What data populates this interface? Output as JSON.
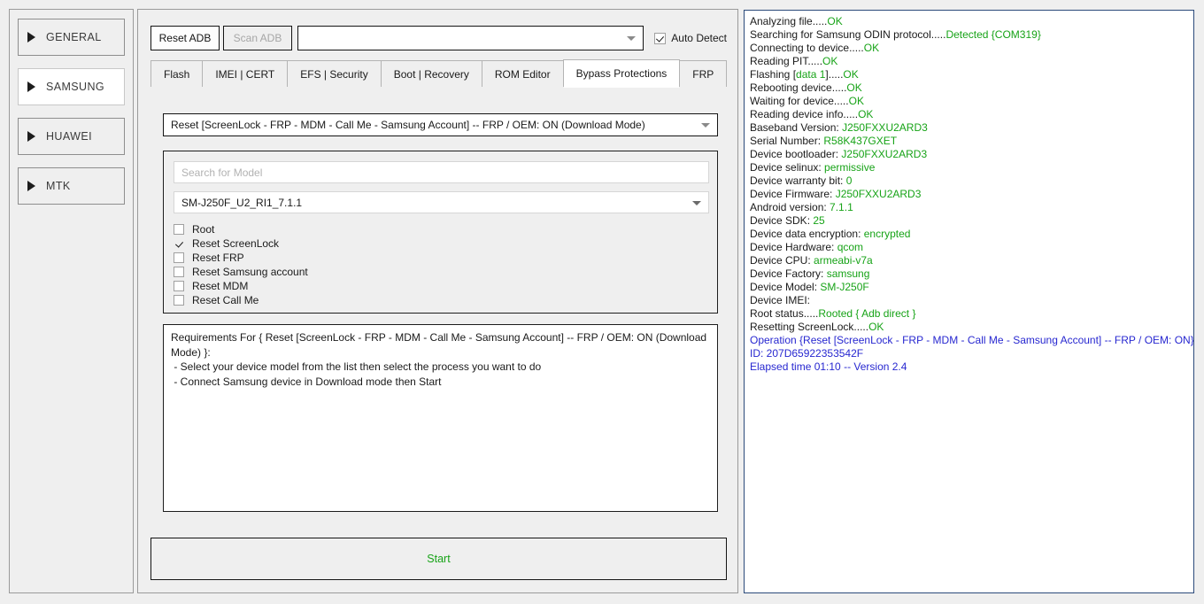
{
  "sidebar": {
    "items": [
      {
        "label": "GENERAL",
        "selected": false
      },
      {
        "label": "SAMSUNG",
        "selected": true
      },
      {
        "label": "HUAWEI",
        "selected": false
      },
      {
        "label": "MTK",
        "selected": false
      }
    ]
  },
  "toolbar": {
    "reset_adb_label": "Reset ADB",
    "scan_adb_label": "Scan ADB",
    "port_combo_value": "",
    "auto_detect_label": "Auto Detect",
    "auto_detect_checked": true
  },
  "tabs": [
    {
      "label": "Flash",
      "active": false
    },
    {
      "label": "IMEI | CERT",
      "active": false
    },
    {
      "label": "EFS | Security",
      "active": false
    },
    {
      "label": "Boot | Recovery",
      "active": false
    },
    {
      "label": "ROM Editor",
      "active": false
    },
    {
      "label": "Bypass Protections",
      "active": true
    },
    {
      "label": "FRP",
      "active": false
    }
  ],
  "main": {
    "operation_combo_value": "Reset [ScreenLock - FRP - MDM - Call Me - Samsung Account] -- FRP / OEM: ON (Download Mode)",
    "search_placeholder": "Search for Model",
    "search_value": "",
    "model_combo_value": "SM-J250F_U2_RI1_7.1.1",
    "options": [
      {
        "label": "Root",
        "checked": false
      },
      {
        "label": "Reset ScreenLock",
        "checked": true
      },
      {
        "label": "Reset FRP",
        "checked": false
      },
      {
        "label": "Reset Samsung account",
        "checked": false
      },
      {
        "label": "Reset MDM",
        "checked": false
      },
      {
        "label": "Reset Call Me",
        "checked": false
      }
    ],
    "requirements_text": "Requirements For { Reset [ScreenLock - FRP - MDM - Call Me - Samsung Account] -- FRP / OEM: ON (Download Mode) }:\n - Select your device model from the list then select the process you want to do\n - Connect Samsung device in Download mode then Start",
    "start_label": "Start"
  },
  "log": {
    "lines": [
      [
        {
          "t": "Analyzing file.....",
          "c": "k"
        },
        {
          "t": "OK",
          "c": "g"
        }
      ],
      [
        {
          "t": "Searching for Samsung ODIN protocol.....",
          "c": "k"
        },
        {
          "t": "Detected {COM319}",
          "c": "g"
        }
      ],
      [
        {
          "t": "Connecting to device.....",
          "c": "k"
        },
        {
          "t": "OK",
          "c": "g"
        }
      ],
      [
        {
          "t": "Reading PIT.....",
          "c": "k"
        },
        {
          "t": "OK",
          "c": "g"
        }
      ],
      [
        {
          "t": "Flashing [",
          "c": "k"
        },
        {
          "t": "data 1",
          "c": "g"
        },
        {
          "t": "].....",
          "c": "k"
        },
        {
          "t": "OK",
          "c": "g"
        }
      ],
      [
        {
          "t": "Rebooting device.....",
          "c": "k"
        },
        {
          "t": "OK",
          "c": "g"
        }
      ],
      [
        {
          "t": "Waiting for device.....",
          "c": "k"
        },
        {
          "t": "OK",
          "c": "g"
        }
      ],
      [
        {
          "t": "Reading device info.....",
          "c": "k"
        },
        {
          "t": "OK",
          "c": "g"
        }
      ],
      [
        {
          "t": "Baseband Version: ",
          "c": "k"
        },
        {
          "t": "J250FXXU2ARD3",
          "c": "g"
        }
      ],
      [
        {
          "t": "Serial Number: ",
          "c": "k"
        },
        {
          "t": "R58K437GXET",
          "c": "g"
        }
      ],
      [
        {
          "t": "Device bootloader: ",
          "c": "k"
        },
        {
          "t": "J250FXXU2ARD3",
          "c": "g"
        }
      ],
      [
        {
          "t": "Device selinux: ",
          "c": "k"
        },
        {
          "t": "permissive",
          "c": "g"
        }
      ],
      [
        {
          "t": "Device warranty bit: ",
          "c": "k"
        },
        {
          "t": "0",
          "c": "g"
        }
      ],
      [
        {
          "t": "Device Firmware: ",
          "c": "k"
        },
        {
          "t": "J250FXXU2ARD3",
          "c": "g"
        }
      ],
      [
        {
          "t": "Android version: ",
          "c": "k"
        },
        {
          "t": "7.1.1",
          "c": "g"
        }
      ],
      [
        {
          "t": "Device SDK: ",
          "c": "k"
        },
        {
          "t": "25",
          "c": "g"
        }
      ],
      [
        {
          "t": "Device data encryption: ",
          "c": "k"
        },
        {
          "t": "encrypted",
          "c": "g"
        }
      ],
      [
        {
          "t": "Device Hardware: ",
          "c": "k"
        },
        {
          "t": "qcom",
          "c": "g"
        }
      ],
      [
        {
          "t": "Device CPU: ",
          "c": "k"
        },
        {
          "t": "armeabi-v7a",
          "c": "g"
        }
      ],
      [
        {
          "t": "Device Factory: ",
          "c": "k"
        },
        {
          "t": "samsung",
          "c": "g"
        }
      ],
      [
        {
          "t": "Device Model: ",
          "c": "k"
        },
        {
          "t": "SM-J250F",
          "c": "g"
        }
      ],
      [
        {
          "t": "Device IMEI:",
          "c": "k"
        }
      ],
      [
        {
          "t": "Root status.....",
          "c": "k"
        },
        {
          "t": "Rooted { Adb direct }",
          "c": "g"
        }
      ],
      [
        {
          "t": "Resetting ScreenLock.....",
          "c": "k"
        },
        {
          "t": "OK",
          "c": "g"
        }
      ],
      [
        {
          "t": "Operation {Reset [ScreenLock - FRP - MDM - Call Me - Samsung Account] -- FRP / OEM: ON}",
          "c": "b"
        }
      ],
      [
        {
          "t": "ID: 207D65922353542F",
          "c": "b"
        }
      ],
      [
        {
          "t": "Elapsed time 01:10 -- Version 2.4",
          "c": "b"
        }
      ]
    ]
  },
  "colors": {
    "success_green": "#17a317",
    "info_blue": "#2727d0",
    "panel_bg": "#efefef",
    "log_border": "#2b4a7a"
  }
}
